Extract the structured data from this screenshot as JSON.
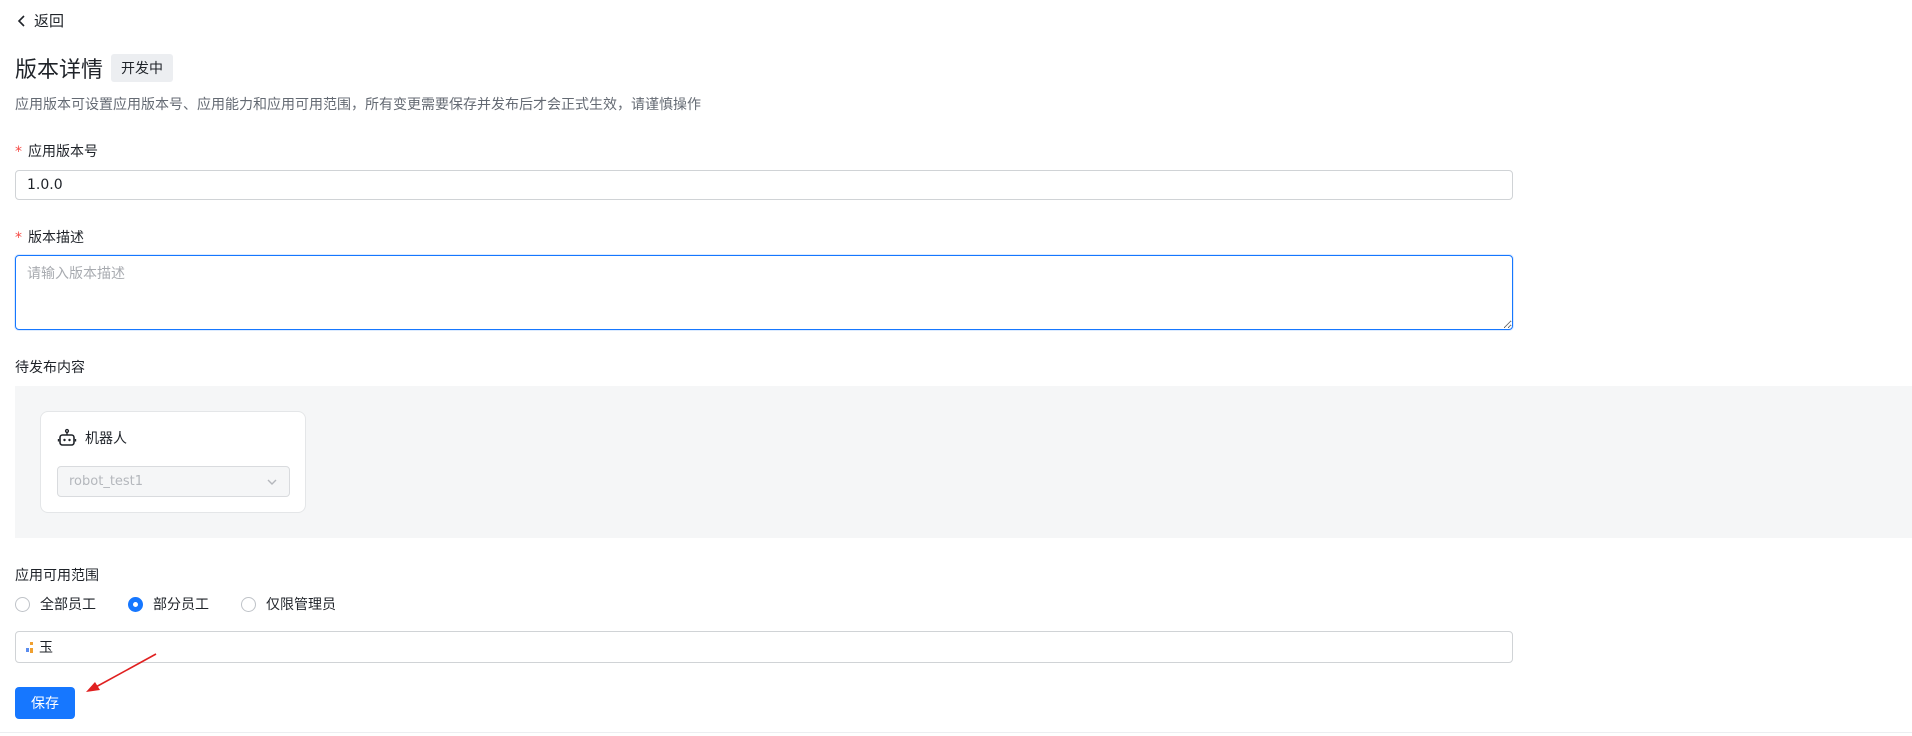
{
  "back": {
    "label": "返回",
    "icon": "chevron-left-icon"
  },
  "header": {
    "title": "版本详情",
    "status": "开发中"
  },
  "description": "应用版本可设置应用版本号、应用能力和应用可用范围，所有变更需要保存并发布后才会正式生效，请谨慎操作",
  "version": {
    "label": "应用版本号",
    "required_mark": "*",
    "value": "1.0.0"
  },
  "version_desc": {
    "label": "版本描述",
    "required_mark": "*",
    "value": "",
    "placeholder": "请输入版本描述"
  },
  "publish": {
    "label": "待发布内容",
    "card": {
      "icon": "robot-icon",
      "title": "机器人",
      "select_value": "robot_test1"
    }
  },
  "scope": {
    "label": "应用可用范围",
    "options": [
      {
        "label": "全部员工",
        "selected": false
      },
      {
        "label": "部分员工",
        "selected": true
      },
      {
        "label": "仅限管理员",
        "selected": false
      }
    ],
    "selected_member": "玉"
  },
  "save_label": "保存",
  "colors": {
    "primary": "#1677ff",
    "required": "#f54a45",
    "annotation_arrow": "#e02020"
  }
}
